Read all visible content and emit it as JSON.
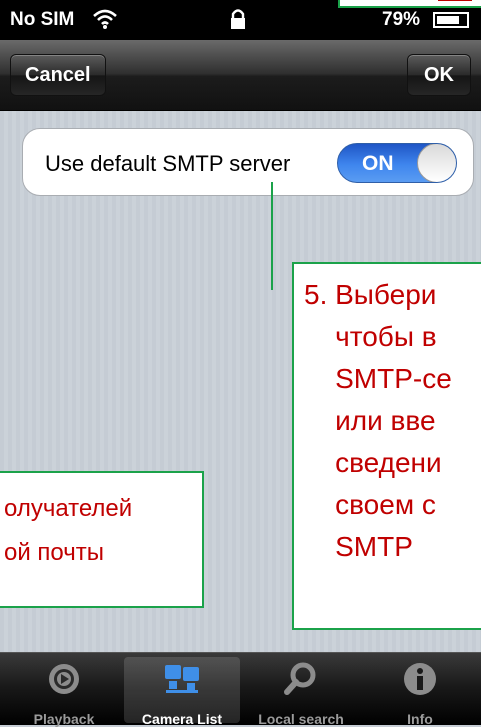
{
  "status_bar": {
    "carrier": "No SIM",
    "battery": "79%"
  },
  "nav": {
    "cancel_label": "Cancel",
    "ok_label": "OK"
  },
  "setting": {
    "label": "Use default SMTP server",
    "toggle_value": "ON",
    "toggle_on": true
  },
  "callouts": {
    "right_text": "5. Выбери\n    чтобы в\n    SMTP-се\n    или вве\n    сведени\n    своем с\n    SMTP",
    "left_text": "олучателей\nой почты"
  },
  "tabs": [
    {
      "label": "Playback",
      "icon": "playback-icon",
      "selected": false
    },
    {
      "label": "Camera List",
      "icon": "camera-list-icon",
      "selected": true
    },
    {
      "label": "Local search",
      "icon": "search-icon",
      "selected": false
    },
    {
      "label": "Info",
      "icon": "info-icon",
      "selected": false
    }
  ],
  "colors": {
    "accent_green": "#1ba24a",
    "callout_text": "#c00000",
    "toggle_blue": "#2f7be6"
  }
}
